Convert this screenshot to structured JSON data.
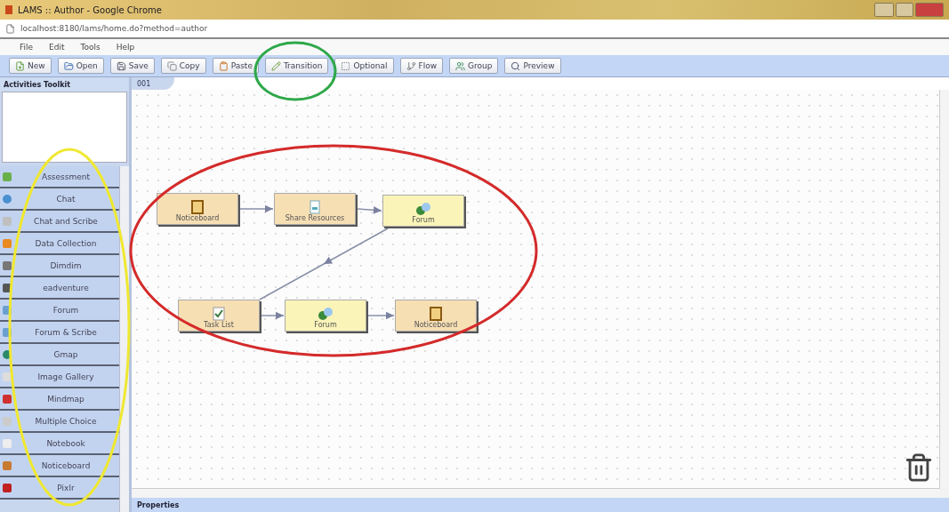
{
  "window": {
    "title": "LAMS :: Author - Google Chrome"
  },
  "address_bar": {
    "url": "localhost:8180/lams/home.do?method=author"
  },
  "menu": [
    "File",
    "Edit",
    "Tools",
    "Help"
  ],
  "toolbar": [
    {
      "label": "New",
      "kind": "new"
    },
    {
      "label": "Open",
      "kind": "open"
    },
    {
      "label": "Save",
      "kind": "save"
    },
    {
      "label": "Copy",
      "kind": "copy"
    },
    {
      "label": "Paste",
      "kind": "paste"
    },
    {
      "label": "Transition",
      "kind": "transition"
    },
    {
      "label": "Optional",
      "kind": "optional"
    },
    {
      "label": "Flow",
      "kind": "flow"
    },
    {
      "label": "Group",
      "kind": "group"
    },
    {
      "label": "Preview",
      "kind": "preview"
    }
  ],
  "toolkit": {
    "title": "Activities Toolkit",
    "items": [
      {
        "label": "Assessment",
        "kind": "assessment"
      },
      {
        "label": "Chat",
        "kind": "chat"
      },
      {
        "label": "Chat and Scribe",
        "kind": "scribe"
      },
      {
        "label": "Data Collection",
        "kind": "data"
      },
      {
        "label": "Dimdim",
        "kind": "dimdim"
      },
      {
        "label": "eadventure",
        "kind": "adventure"
      },
      {
        "label": "Forum",
        "kind": "forum"
      },
      {
        "label": "Forum & Scribe",
        "kind": "forum"
      },
      {
        "label": "Gmap",
        "kind": "map"
      },
      {
        "label": "Image Gallery",
        "kind": "gallery"
      },
      {
        "label": "Mindmap",
        "kind": "mindmap"
      },
      {
        "label": "Multiple Choice",
        "kind": "choice"
      },
      {
        "label": "Notebook",
        "kind": "notebook"
      },
      {
        "label": "Noticeboard",
        "kind": "noticeboard"
      },
      {
        "label": "Pixlr",
        "kind": "pixlr"
      }
    ]
  },
  "canvas": {
    "tab": "001",
    "nodes": [
      {
        "label": "Noticeboard",
        "kind": "noticeboard"
      },
      {
        "label": "Share Resources",
        "kind": "resources"
      },
      {
        "label": "Forum",
        "kind": "forum"
      },
      {
        "label": "Task List",
        "kind": "tasklist"
      },
      {
        "label": "Forum",
        "kind": "forum"
      },
      {
        "label": "Noticeboard",
        "kind": "noticeboard"
      }
    ]
  },
  "properties": {
    "title": "Properties"
  },
  "annotations": [
    {
      "color": "#2ea84a"
    },
    {
      "color": "#d42a2a"
    },
    {
      "color": "#f0e830"
    }
  ]
}
